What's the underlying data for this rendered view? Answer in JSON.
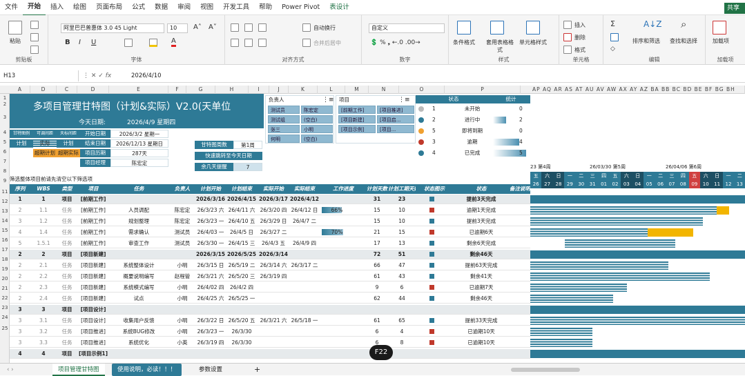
{
  "menu": [
    "文件",
    "开始",
    "插入",
    "绘图",
    "页面布局",
    "公式",
    "数据",
    "审阅",
    "视图",
    "开发工具",
    "帮助",
    "Power Pivot",
    "表设计"
  ],
  "share_label": "共享",
  "ribbon": {
    "paste": "粘贴",
    "clipboard": "剪贴板",
    "font_name": "阿里巴巴普惠体 3.0 45 Light",
    "font_size": "10",
    "font_group": "字体",
    "wrap": "自动换行",
    "merge": "合并后居中",
    "align_group": "对齐方式",
    "num_format": "自定义",
    "num_group": "数字",
    "cond_fmt": "条件格式",
    "table_fmt": "套用表格格式",
    "cell_style": "单元格样式",
    "style_group": "样式",
    "insert": "插入",
    "delete": "删除",
    "format": "格式",
    "cells_group": "单元格",
    "sort": "排序和筛选",
    "find": "查找和选择",
    "edit_group": "编辑",
    "addin": "加载项",
    "addin_group": "加载项"
  },
  "formula_bar": {
    "name_box": "H13",
    "value": "2026/4/10"
  },
  "columns": [
    "A",
    "D",
    "C",
    "D",
    "E",
    "F",
    "G",
    "H",
    "I",
    "J",
    "K",
    "L",
    "M",
    "N",
    "O",
    "P"
  ],
  "gantt_columns": "AP AQ AR AS AT AU AV AW AX AY AZ BA BB BC BD BE BF BG BH",
  "row_numbers": [
    "1",
    "2",
    "3",
    "4",
    "5",
    "6",
    "7",
    "8",
    "9",
    "11",
    "12",
    "13",
    "14",
    "15",
    "16",
    "17",
    "18",
    "19",
    "20",
    "21",
    "22",
    "23",
    "24",
    "25"
  ],
  "title": "多项目管理甘特图（计划&实际）V2.0(天单位",
  "today_label": "今天日期:",
  "today_value": "2026/4/9 星期四",
  "legend": {
    "h1": "甘特图例",
    "h2": "可调间距",
    "h3": "天标间距",
    "a": "计划",
    "b": "实际",
    "c": "计划",
    "d": "超期计划",
    "e": "超期实际"
  },
  "info": [
    {
      "label": "开始日期",
      "value": "2026/3/2 星期一"
    },
    {
      "label": "结束日期",
      "value": "2026/12/13 星期日"
    },
    {
      "label": "项目历期",
      "value": "287天"
    },
    {
      "label": "项目经理",
      "value": "陈宏定"
    }
  ],
  "week": {
    "label": "甘特图周数",
    "value": "第1周",
    "label2": "快速跳转至今天日期",
    "label3": "余几天提醒",
    "value3": "7"
  },
  "note": "筛选整体项目前请先清空以下筛选项",
  "slicer_person": {
    "title": "负责人",
    "items": [
      "测试员",
      "陈宏定",
      "测试组",
      "(空白)",
      "张三",
      "小明",
      "何明",
      "(空白)"
    ]
  },
  "slicer_project": {
    "title": "项目",
    "items": [
      "[前期工作]",
      "[项目推进]",
      "[项目新建]",
      "[项目启...",
      "[项目示例]",
      "[项目..."
    ]
  },
  "status": {
    "title": "状态",
    "count_title": "统计",
    "items": [
      {
        "n": "1",
        "label": "未开始",
        "count": "0",
        "color": "#bbbbbb"
      },
      {
        "n": "2",
        "label": "进行中",
        "count": "2",
        "color": "#2e7a96"
      },
      {
        "n": "5",
        "label": "即将到期",
        "count": "0",
        "color": "#f0a030"
      },
      {
        "n": "3",
        "label": "逾期",
        "count": "4",
        "color": "#c0392b"
      },
      {
        "n": "4",
        "label": "已完成",
        "count": "5",
        "color": "#2e7a96"
      }
    ]
  },
  "gantt_dates": {
    "weeks": [
      "23 第4周",
      "26/03/30 第5周",
      "26/04/06 第6周"
    ],
    "days": [
      "26",
      "27",
      "28",
      "29",
      "30",
      "31",
      "01",
      "02",
      "03",
      "04",
      "05",
      "06",
      "07",
      "08",
      "09",
      "10",
      "11",
      "12",
      "13"
    ],
    "weekday": [
      "五",
      "六",
      "日",
      "一",
      "二",
      "三",
      "四",
      "五",
      "六",
      "日",
      "一",
      "二",
      "三",
      "四",
      "五",
      "六",
      "日",
      "一",
      "二"
    ]
  },
  "headers": [
    "序列",
    "WBS",
    "类型",
    "项目",
    "任务",
    "负责人",
    "计划开始",
    "计划结束",
    "实际开始",
    "实际结束",
    "工作进度",
    "计划天数",
    "计划工期天数",
    "状态图示",
    "状态",
    "备注说明"
  ],
  "rows": [
    {
      "n": "1",
      "wbs": "1",
      "type": "项目",
      "proj": "[前期工作]",
      "task": "",
      "owner": "",
      "ps": "2026/3/16",
      "pe": "2026/4/15",
      "as": "2026/3/17",
      "ae": "2026/4/12",
      "prog": "",
      "pd": "31",
      "pw": "23",
      "state": "提前3天完成",
      "major": true
    },
    {
      "n": "2",
      "wbs": "1.1",
      "type": "任务",
      "proj": "[前期工作]",
      "task": "人员调配",
      "owner": "陈宏定",
      "ps": "26/3/23 六",
      "pe": "26/4/11 六",
      "as": "26/3/20 四",
      "ae": "26/4/12 日",
      "prog": "66%",
      "pd": "15",
      "pw": "10",
      "state": "逾期1天完成"
    },
    {
      "n": "3",
      "wbs": "1.2",
      "type": "任务",
      "proj": "[前期工作]",
      "task": "规划整理",
      "owner": "陈宏定",
      "ps": "26/3/23 一",
      "pe": "26/4/10 五",
      "as": "26/3/29 日",
      "ae": "26/4/7 二",
      "prog": "",
      "pd": "15",
      "pw": "10",
      "state": "提前3天完成"
    },
    {
      "n": "4",
      "wbs": "1.4",
      "type": "任务",
      "proj": "[前期工作]",
      "task": "需求确认",
      "owner": "测试员",
      "ps": "26/4/03 一",
      "pe": "26/4/5 日",
      "as": "26/3/27 二",
      "ae": "",
      "prog": "70%",
      "pd": "21",
      "pw": "15",
      "state": "已逾期6天"
    },
    {
      "n": "5",
      "wbs": "1.5.1",
      "type": "任务",
      "proj": "[前期工作]",
      "task": "审查工作",
      "owner": "测试员",
      "ps": "26/3/30 一",
      "pe": "26/4/15 三",
      "as": "26/4/3 五",
      "ae": "26/4/9 四",
      "prog": "",
      "pd": "17",
      "pw": "13",
      "state": "剩余6天完成"
    },
    {
      "n": "2",
      "wbs": "2",
      "type": "项目",
      "proj": "[项目新建]",
      "task": "",
      "owner": "",
      "ps": "2026/3/15",
      "pe": "2026/5/25",
      "as": "2026/3/14",
      "ae": "",
      "prog": "",
      "pd": "72",
      "pw": "51",
      "state": "剩余46天",
      "major": true
    },
    {
      "n": "2",
      "wbs": "2.1",
      "type": "任务",
      "proj": "[项目新建]",
      "task": "系统整体设计",
      "owner": "小明",
      "ps": "26/3/15 日",
      "pe": "26/5/19 二",
      "as": "26/3/14 六",
      "ae": "26/3/17 二",
      "prog": "",
      "pd": "66",
      "pw": "47",
      "state": "提前63天完成"
    },
    {
      "n": "2",
      "wbs": "2.2",
      "type": "任务",
      "proj": "[项目新建]",
      "task": "概要说明编写",
      "owner": "赵程管",
      "ps": "26/3/21 六",
      "pe": "26/5/20 三",
      "as": "26/3/19 四",
      "ae": "",
      "prog": "",
      "pd": "61",
      "pw": "43",
      "state": "剩余41天"
    },
    {
      "n": "2",
      "wbs": "2.3",
      "type": "任务",
      "proj": "[项目新建]",
      "task": "系统模式编写",
      "owner": "小明",
      "ps": "26/4/02 四",
      "pe": "26/4/2 四",
      "as": "",
      "ae": "",
      "prog": "",
      "pd": "9",
      "pw": "6",
      "state": "已逾期7天"
    },
    {
      "n": "2",
      "wbs": "2.4",
      "type": "任务",
      "proj": "[项目新建]",
      "task": "试点",
      "owner": "小明",
      "ps": "26/4/25 六",
      "pe": "26/5/25 一",
      "as": "",
      "ae": "",
      "prog": "",
      "pd": "62",
      "pw": "44",
      "state": "剩余46天"
    },
    {
      "n": "3",
      "wbs": "3",
      "type": "项目",
      "proj": "[项目设计]",
      "task": "",
      "owner": "",
      "ps": "",
      "pe": "",
      "as": "",
      "ae": "",
      "prog": "",
      "pd": "",
      "pw": "",
      "state": "",
      "major": true
    },
    {
      "n": "3",
      "wbs": "3.1",
      "type": "任务",
      "proj": "[项目设计]",
      "task": "收集用户反馈",
      "owner": "小明",
      "ps": "26/3/22 日",
      "pe": "26/5/20 五",
      "as": "26/3/21 六",
      "ae": "26/5/18 一",
      "prog": "",
      "pd": "61",
      "pw": "65",
      "state": "提前33天完成"
    },
    {
      "n": "3",
      "wbs": "3.2",
      "type": "任务",
      "proj": "[项目推进]",
      "task": "系统BUG修改",
      "owner": "小明",
      "ps": "26/3/23 一",
      "pe": "26/3/30",
      "as": "",
      "ae": "",
      "prog": "",
      "pd": "6",
      "pw": "4",
      "state": "已逾期10天"
    },
    {
      "n": "3",
      "wbs": "3.3",
      "type": "任务",
      "proj": "[项目推进]",
      "task": "系统优化",
      "owner": "小英",
      "ps": "26/3/19 四",
      "pe": "26/3/30",
      "as": "",
      "ae": "",
      "prog": "",
      "pd": "6",
      "pw": "8",
      "state": "已逾期10天"
    },
    {
      "n": "4",
      "wbs": "4",
      "type": "项目",
      "proj": "[项目示例1]",
      "task": "",
      "owner": "",
      "ps": "",
      "pe": "",
      "as": "",
      "ae": "",
      "prog": "",
      "pd": "",
      "pw": "",
      "state": "",
      "major": true
    }
  ],
  "tabs": [
    "项目管理甘特图",
    "使用说明，必读！！！",
    "参数设置"
  ],
  "add_sheet": "+",
  "badge": "F22"
}
